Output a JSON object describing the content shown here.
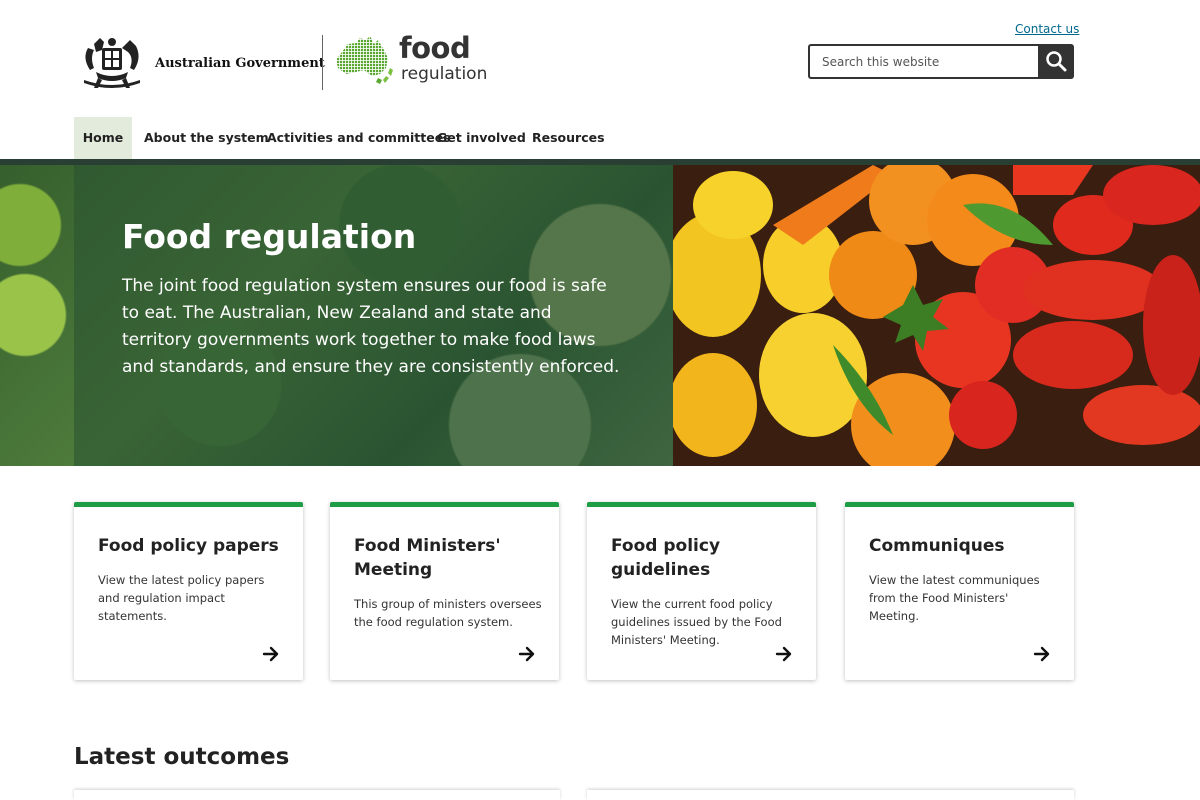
{
  "header": {
    "contact_link": "Contact us",
    "search_placeholder": "Search this website",
    "gov_logo_text": "Australian Government",
    "food_logo_word1": "food",
    "food_logo_word2": "regulation"
  },
  "nav": {
    "items": [
      "Home",
      "About the system",
      "Activities and committees",
      "Get involved",
      "Resources"
    ]
  },
  "hero": {
    "title": "Food regulation",
    "text": "The joint food regulation system ensures our food is safe to eat. The Australian, New Zealand and state and territory governments work together to make food laws and standards, and ensure they are consistently enforced."
  },
  "cards": [
    {
      "title": "Food policy papers",
      "desc": "View the latest policy papers and regulation impact statements."
    },
    {
      "title": "Food Ministers' Meeting",
      "desc": "This group of ministers oversees the food regulation system."
    },
    {
      "title": "Food policy guidelines",
      "desc": "View the current food policy guidelines issued by the Food Ministers' Meeting."
    },
    {
      "title": "Communiques",
      "desc": "View the latest communiques from the Food Ministers' Meeting."
    }
  ],
  "latest": {
    "heading": "Latest outcomes"
  },
  "colors": {
    "accent_green": "#1f9c46",
    "nav_active_bg": "#e3ecdc",
    "nav_bar": "#2a3f34",
    "link": "#00698f"
  },
  "icons": [
    "coat-of-arms-icon",
    "australia-map-icon",
    "search-icon",
    "arrow-right-icon"
  ]
}
